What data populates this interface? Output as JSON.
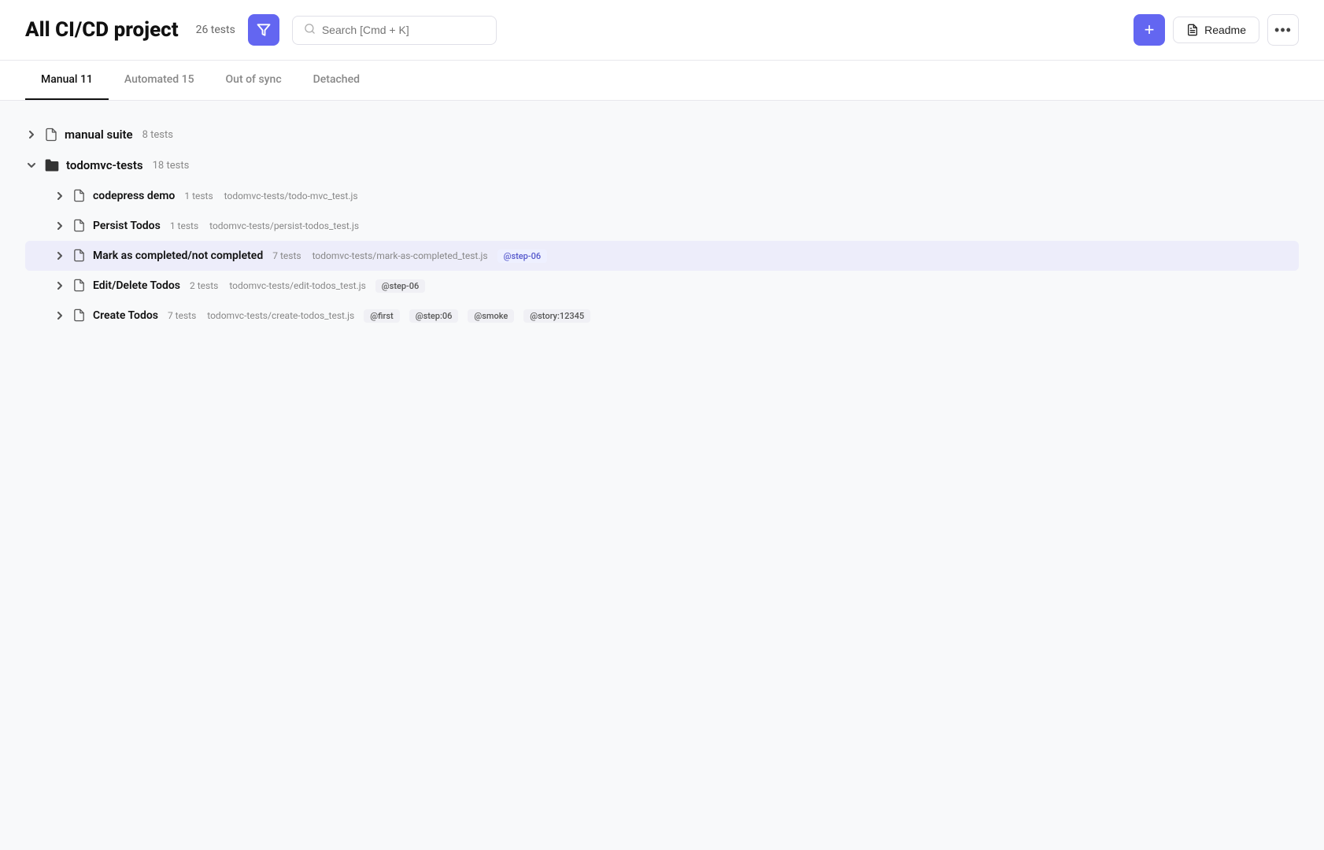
{
  "header": {
    "title": "All CI/CD project",
    "tests_count": "26 tests",
    "search_placeholder": "Search [Cmd + K]",
    "readme_label": "Readme",
    "add_label": "+"
  },
  "tabs": [
    {
      "id": "manual",
      "label": "Manual",
      "count": "11",
      "active": true
    },
    {
      "id": "automated",
      "label": "Automated",
      "count": "15",
      "active": false
    },
    {
      "id": "out-of-sync",
      "label": "Out of sync",
      "count": "",
      "active": false
    },
    {
      "id": "detached",
      "label": "Detached",
      "count": "",
      "active": false
    }
  ],
  "suites": [
    {
      "id": "manual-suite",
      "name": "manual suite",
      "count": "8 tests",
      "type": "file",
      "expanded": false,
      "indent": 0
    },
    {
      "id": "todomvc-tests",
      "name": "todomvc-tests",
      "count": "18 tests",
      "type": "folder",
      "expanded": true,
      "indent": 0,
      "children": [
        {
          "id": "codepress-demo",
          "name": "codepress demo",
          "count": "1 tests",
          "path": "todomvc-tests/todo-mvc_test.js",
          "tags": [],
          "indent": 1,
          "highlighted": false
        },
        {
          "id": "persist-todos",
          "name": "Persist Todos",
          "count": "1 tests",
          "path": "todomvc-tests/persist-todos_test.js",
          "tags": [],
          "indent": 1,
          "highlighted": false
        },
        {
          "id": "mark-as-completed",
          "name": "Mark as completed/not completed",
          "count": "7 tests",
          "path": "todomvc-tests/mark-as-completed_test.js",
          "tags": [
            "@step-06"
          ],
          "indent": 1,
          "highlighted": true
        },
        {
          "id": "edit-delete-todos",
          "name": "Edit/Delete Todos",
          "count": "2 tests",
          "path": "todomvc-tests/edit-todos_test.js",
          "tags": [
            "@step-06"
          ],
          "indent": 1,
          "highlighted": false
        },
        {
          "id": "create-todos",
          "name": "Create Todos",
          "count": "7 tests",
          "path": "todomvc-tests/create-todos_test.js",
          "tags": [
            "@first",
            "@step:06",
            "@smoke",
            "@story:12345"
          ],
          "indent": 1,
          "highlighted": false
        }
      ]
    }
  ]
}
